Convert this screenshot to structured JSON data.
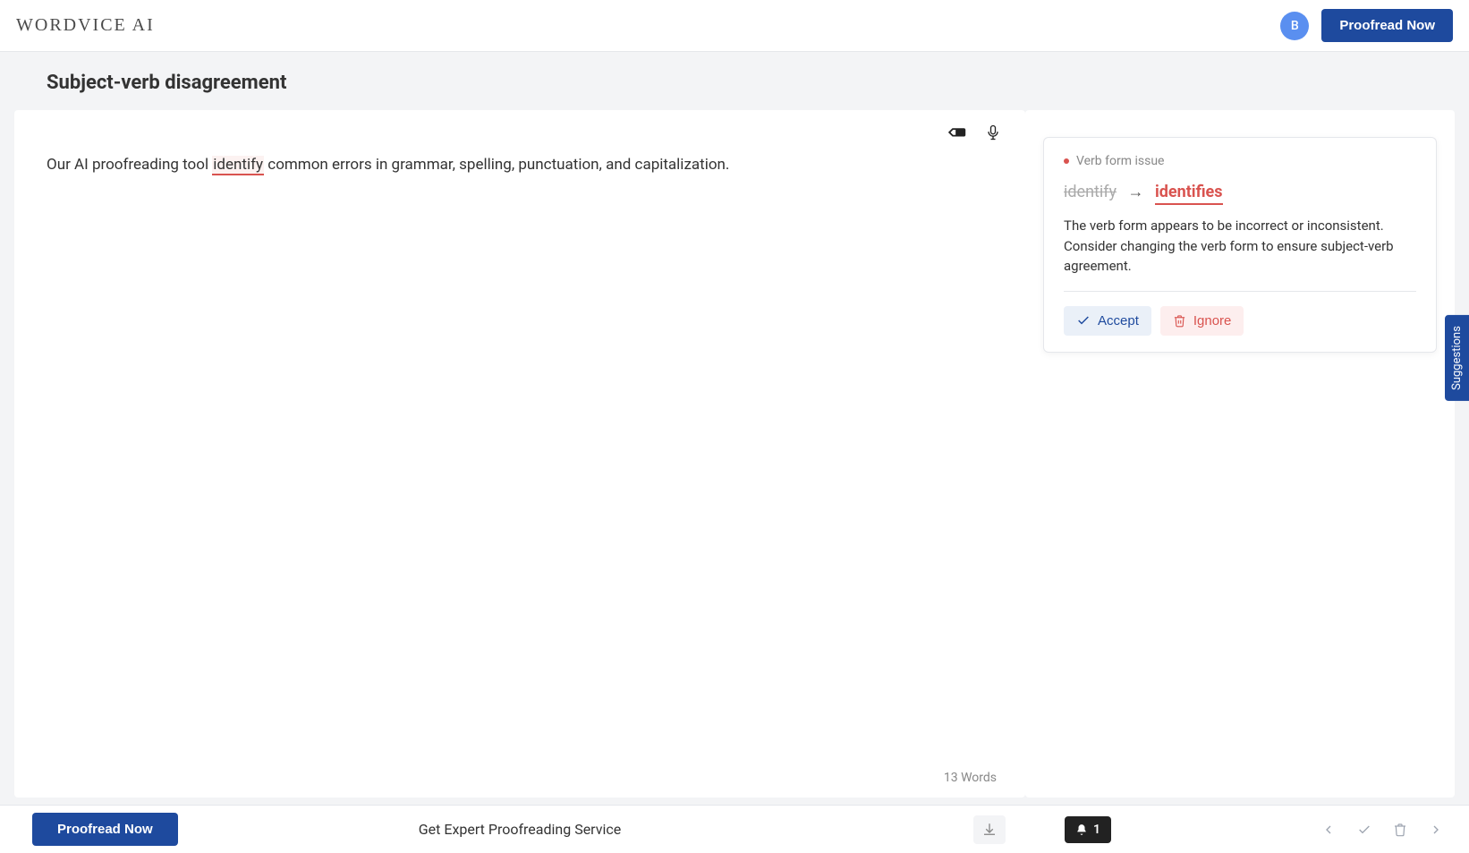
{
  "header": {
    "logo": "WORDVICE AI",
    "avatar_initial": "B",
    "proofread_button": "Proofread Now"
  },
  "page": {
    "title": "Subject-verb disagreement"
  },
  "editor": {
    "text_before": "Our AI proofreading tool ",
    "error_word": "identify",
    "text_after": " common errors in grammar, spelling, punctuation, and capitalization.",
    "word_count_label": "13 Words"
  },
  "suggestion": {
    "issue_type": "Verb form issue",
    "original": "identify",
    "replacement": "identifies",
    "explanation": "The verb form appears to be incorrect or inconsistent. Consider changing the verb form to ensure subject-verb agreement.",
    "accept_label": "Accept",
    "ignore_label": "Ignore"
  },
  "side_tab": {
    "label": "Suggestions"
  },
  "bottom": {
    "proofread_button": "Proofread Now",
    "service_link": "Get Expert Proofreading Service",
    "notification_count": "1"
  }
}
